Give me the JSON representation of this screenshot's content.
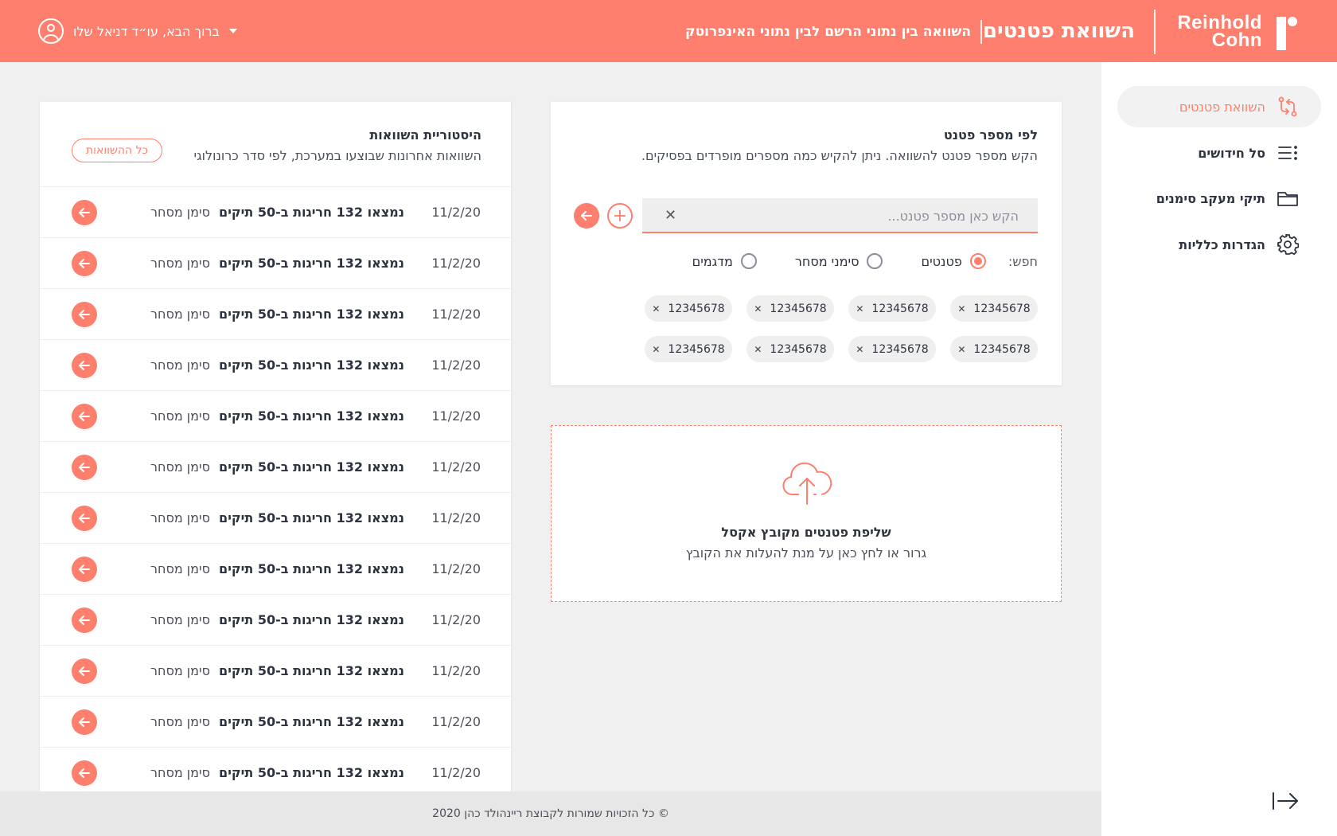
{
  "header": {
    "logo_line1": "Reinhold",
    "logo_line2": "Cohn",
    "title": "השוואת פטנטים",
    "subtitle": "השוואה בין נתוני הרשם לבין נתוני האינפרוטק",
    "user_greeting": "ברוך הבא, עו״ד דניאל שלו"
  },
  "sidebar": {
    "items": [
      {
        "label": "השוואת פטנטים",
        "icon": "compare-icon",
        "active": true
      },
      {
        "label": "סל חידושים",
        "icon": "list-icon",
        "active": false
      },
      {
        "label": "תיקי מעקב סימנים",
        "icon": "folder-icon",
        "active": false
      },
      {
        "label": "הגדרות כלליות",
        "icon": "gear-icon",
        "active": false
      }
    ],
    "logout_icon": "logout-arrow-icon"
  },
  "search": {
    "title": "לפי מספר פטנט",
    "description": "הקש מספר פטנט להשוואה. ניתן להקיש כמה מספרים מופרדים בפסיקים.",
    "placeholder": "הקש כאן מספר פטנט...",
    "value": "",
    "search_label": "חפש:",
    "options": [
      {
        "label": "פטנטים",
        "selected": true
      },
      {
        "label": "סימני מסחר",
        "selected": false
      },
      {
        "label": "מדגמים",
        "selected": false
      }
    ],
    "chips": [
      "12345678",
      "12345678",
      "12345678",
      "12345678",
      "12345678",
      "12345678",
      "12345678",
      "12345678"
    ]
  },
  "upload": {
    "title": "שליפת פטנטים מקובץ אקסל",
    "description": "גרור או לחץ כאן על מנת להעלות את הקובץ",
    "icon": "cloud-upload-icon"
  },
  "history": {
    "title": "היסטוריית השוואות",
    "description": "השוואות אחרונות שבוצעו במערכת, לפי סדר כרונולוגי",
    "all_button": "כל ההשוואות",
    "rows": [
      {
        "date": "11/2/20",
        "result": "נמצאו 132 חריגות ב-50 תיקים",
        "type": "סימן מסחר"
      },
      {
        "date": "11/2/20",
        "result": "נמצאו 132 חריגות ב-50 תיקים",
        "type": "סימן מסחר"
      },
      {
        "date": "11/2/20",
        "result": "נמצאו 132 חריגות ב-50 תיקים",
        "type": "סימן מסחר"
      },
      {
        "date": "11/2/20",
        "result": "נמצאו 132 חריגות ב-50 תיקים",
        "type": "סימן מסחר"
      },
      {
        "date": "11/2/20",
        "result": "נמצאו 132 חריגות ב-50 תיקים",
        "type": "סימן מסחר"
      },
      {
        "date": "11/2/20",
        "result": "נמצאו 132 חריגות ב-50 תיקים",
        "type": "סימן מסחר"
      },
      {
        "date": "11/2/20",
        "result": "נמצאו 132 חריגות ב-50 תיקים",
        "type": "סימן מסחר"
      },
      {
        "date": "11/2/20",
        "result": "נמצאו 132 חריגות ב-50 תיקים",
        "type": "סימן מסחר"
      },
      {
        "date": "11/2/20",
        "result": "נמצאו 132 חריגות ב-50 תיקים",
        "type": "סימן מסחר"
      },
      {
        "date": "11/2/20",
        "result": "נמצאו 132 חריגות ב-50 תיקים",
        "type": "סימן מסחר"
      },
      {
        "date": "11/2/20",
        "result": "נמצאו 132 חריגות ב-50 תיקים",
        "type": "סימן מסחר"
      },
      {
        "date": "11/2/20",
        "result": "נמצאו 132 חריגות ב-50 תיקים",
        "type": "סימן מסחר"
      }
    ]
  },
  "footer": {
    "copyright": "© כל הזכויות שמורות לקבוצת ריינהולד כהן 2020"
  },
  "colors": {
    "accent": "#ff7f6e",
    "text": "#2e3340",
    "background": "#f0f0f0"
  }
}
